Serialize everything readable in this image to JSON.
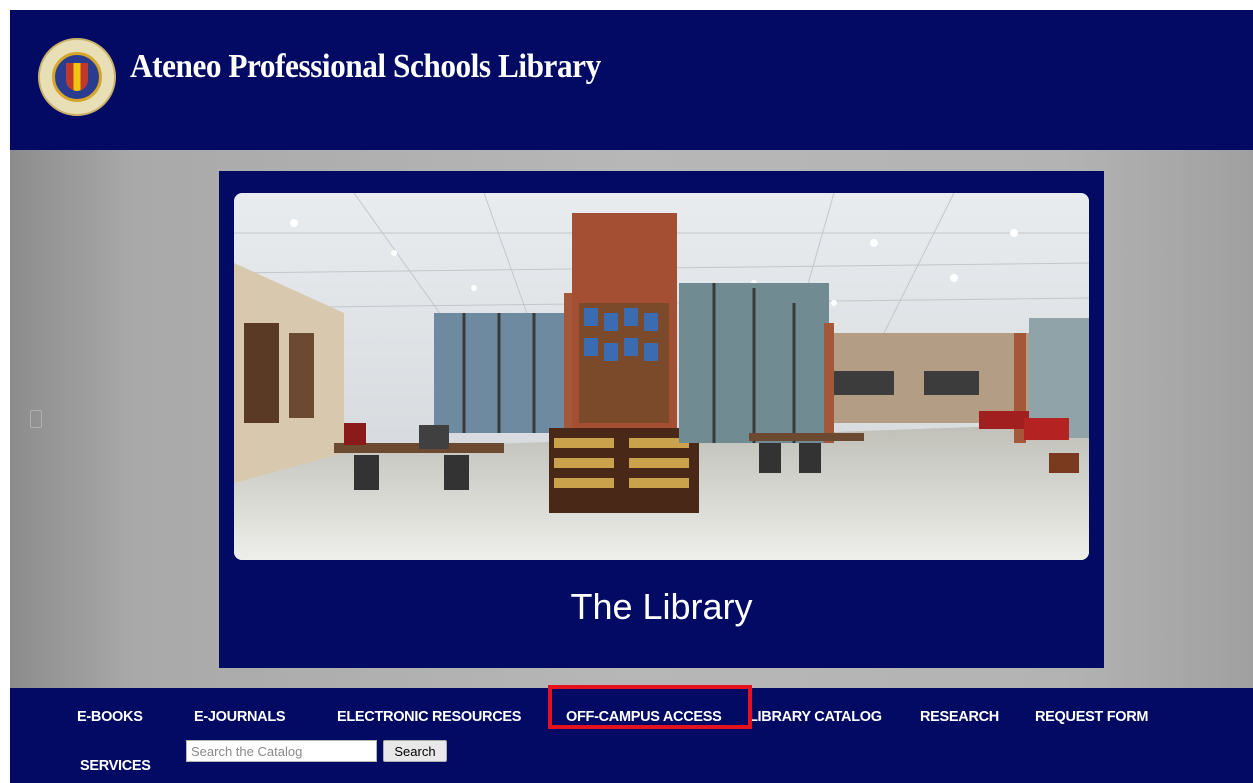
{
  "header": {
    "title": "Ateneo Professional Schools Library",
    "logo_icon": "ateneo-seal-icon"
  },
  "slide": {
    "caption": "The Library",
    "image": "library-interior-panorama"
  },
  "nav": {
    "items": [
      {
        "label": "E-BOOKS"
      },
      {
        "label": "E-JOURNALS"
      },
      {
        "label": "ELECTRONIC RESOURCES"
      },
      {
        "label": "OFF-CAMPUS ACCESS"
      },
      {
        "label": "LIBRARY CATALOG"
      },
      {
        "label": "RESEARCH"
      },
      {
        "label": "REQUEST FORM"
      },
      {
        "label": "SERVICES"
      }
    ],
    "highlighted_item": "OFF-CAMPUS ACCESS",
    "highlight_color": "#e3121e"
  },
  "search": {
    "placeholder": "Search the Catalog",
    "value": "",
    "button_label": "Search"
  },
  "colors": {
    "brand_navy": "#020a63"
  }
}
